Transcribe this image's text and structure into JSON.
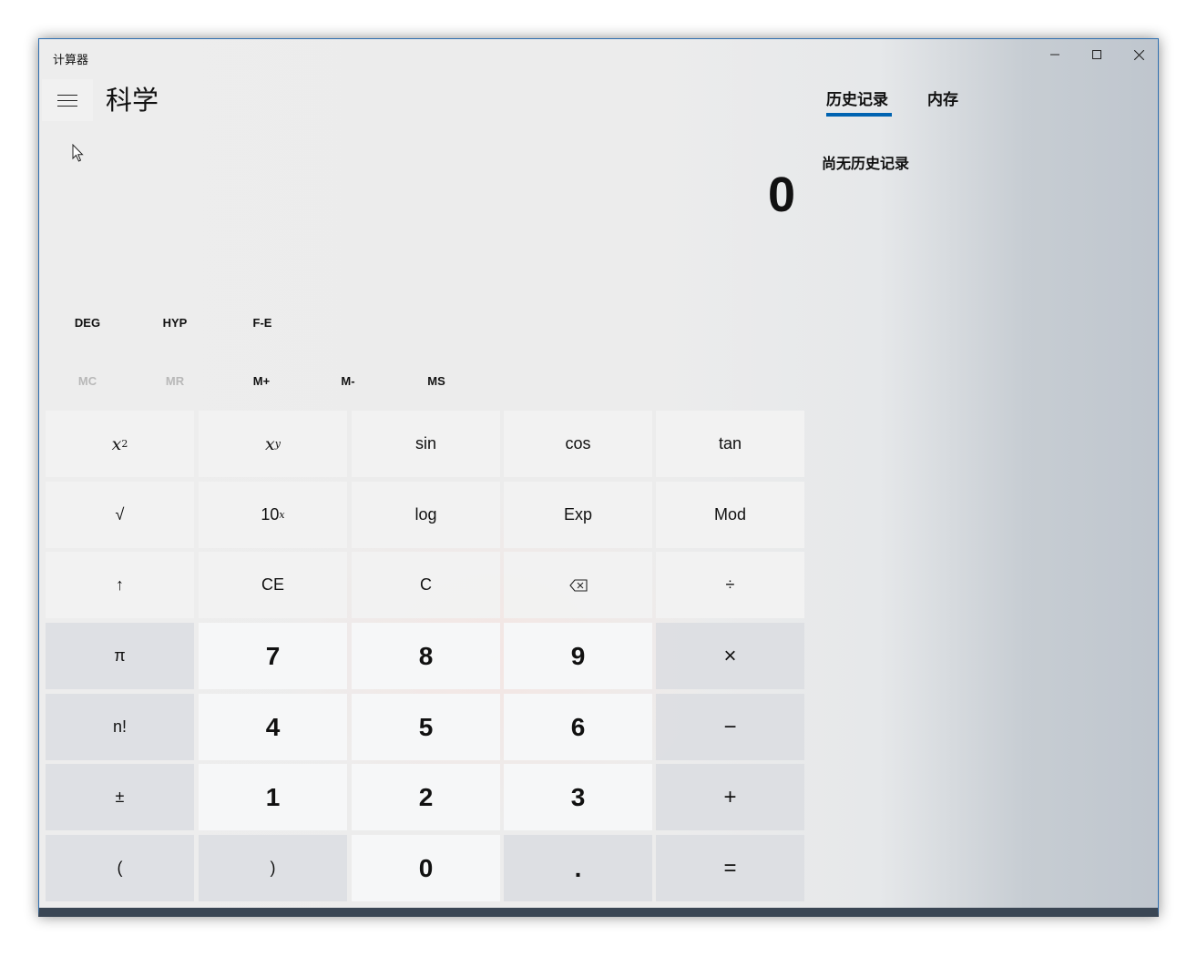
{
  "window": {
    "title": "计算器",
    "minimize_icon": "minimize-icon",
    "maximize_icon": "maximize-icon",
    "close_icon": "close-icon"
  },
  "header": {
    "menu_icon": "hamburger-icon",
    "mode_title": "科学"
  },
  "display": {
    "value": "0"
  },
  "toggles": {
    "angle": "DEG",
    "hyp": "HYP",
    "fe": "F-E"
  },
  "memory": {
    "mc": "MC",
    "mr": "MR",
    "mplus": "M+",
    "mminus": "M-",
    "ms": "MS",
    "mc_enabled": false,
    "mr_enabled": false
  },
  "keys": {
    "row1": [
      "x²",
      "xʸ",
      "sin",
      "cos",
      "tan"
    ],
    "row2": [
      "√",
      "10ˣ",
      "log",
      "Exp",
      "Mod"
    ],
    "row3": [
      "↑",
      "CE",
      "C",
      "backspace-icon",
      "÷"
    ],
    "row4": [
      "π",
      "7",
      "8",
      "9",
      "×"
    ],
    "row5": [
      "n!",
      "4",
      "5",
      "6",
      "−"
    ],
    "row6": [
      "±",
      "1",
      "2",
      "3",
      "+"
    ],
    "row7": [
      "(",
      ")",
      "0",
      ".",
      "="
    ],
    "x_base": "x",
    "x_sq_sup": "2",
    "y_sup": "y",
    "ten_base": "10",
    "ten_sup": "x"
  },
  "panel": {
    "tab_history": "历史记录",
    "tab_memory": "内存",
    "active_tab": "历史记录",
    "empty_history": "尚无历史记录"
  },
  "colors": {
    "accent": "#0063b1"
  }
}
